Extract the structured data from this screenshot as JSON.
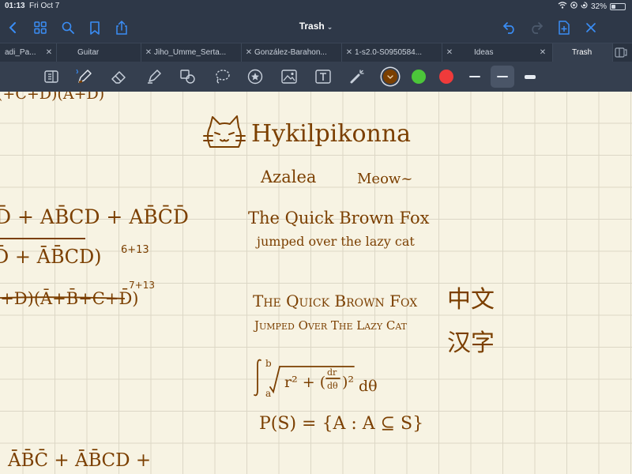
{
  "status_bar": {
    "time": "01:13",
    "date": "Fri Oct 7",
    "battery_percent": "32%",
    "battery_level": 0.32
  },
  "nav": {
    "title": "Trash",
    "icons": [
      "back-icon",
      "grid-icon",
      "search-icon",
      "bookmark-icon",
      "share-icon",
      "undo-icon",
      "redo-icon",
      "new-page-icon",
      "close-icon"
    ]
  },
  "tabs": [
    {
      "label": "adi_Pa...",
      "active": false
    },
    {
      "label": "Guitar",
      "active": false
    },
    {
      "label": "Jiho_Umme_Serta...",
      "active": false
    },
    {
      "label": "González-Barahon...",
      "active": false
    },
    {
      "label": "1-s2.0-S0950584...",
      "active": false
    },
    {
      "label": "Ideas",
      "active": false
    },
    {
      "label": "Trash",
      "active": true
    }
  ],
  "toolbar": {
    "tools": [
      "reader-icon",
      "pen-icon",
      "eraser-icon",
      "highlighter-icon",
      "shapes-icon",
      "lasso-icon",
      "sticker-icon",
      "image-icon",
      "text-icon",
      "laser-icon"
    ],
    "colors": [
      "#7b3f00",
      "#4cc63a",
      "#ef3b3b"
    ],
    "selected_color": "#7b3f00",
    "selected_width": "medium"
  },
  "note": {
    "title": "Hykilpikonna",
    "sub_left": "Azalea",
    "sub_right": "Meow~",
    "fox_line1": "The Quick Brown Fox",
    "fox_line2": "jumped over the lazy cat",
    "fox_caps_line1": "The Quick Brown Fox",
    "fox_caps_line2": "Jumped Over The Lazy Cat",
    "chinese_1": "中文",
    "chinese_2": "汉字",
    "set_def": "P(S) = {A : A ⊆ S}",
    "integral_end": "dθ",
    "math_top": "(+C+D)(A+D)",
    "math_a": "D̄ + AB̄CD + AB̄C̄D̄",
    "math_b": "D̄ + ĀB̄CD)",
    "math_b_note": "6+13",
    "math_c": "(+D)(Ā+B̄+C+D̄)",
    "math_c_note": "7+13",
    "math_d": "ĀB̄C̄ + ĀB̄CD +"
  }
}
